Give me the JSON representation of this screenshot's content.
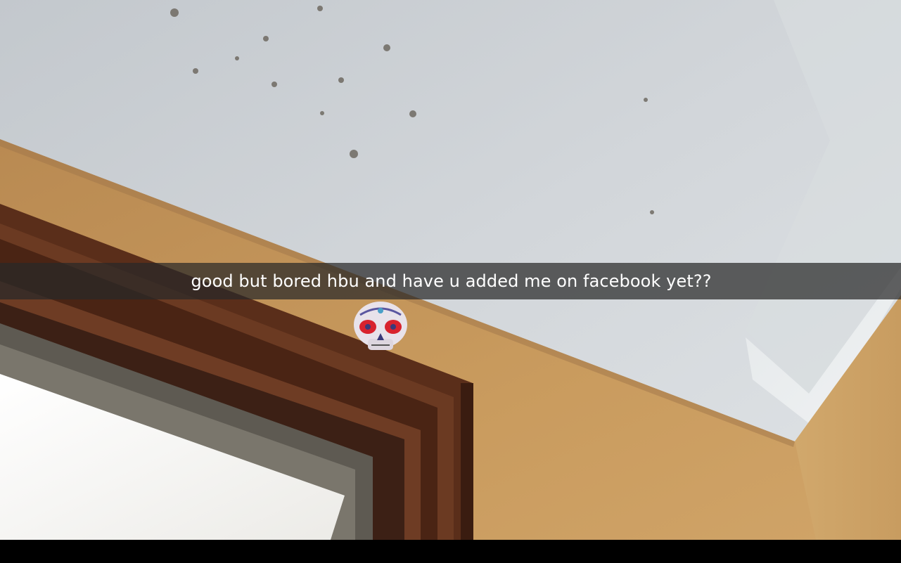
{
  "snap": {
    "caption": "good but bored hbu and have u added me on facebook yet??"
  },
  "colors": {
    "ceiling": "#c9ced3",
    "wall": "#c89a5c",
    "door_frame": "#5a2e1a",
    "window_glow": "#f4f4f2",
    "caption_bar": "#282828",
    "caption_text": "#ffffff",
    "bottom_bar": "#000000"
  },
  "icons": {
    "sticker": "sugar-skull-sticker"
  }
}
